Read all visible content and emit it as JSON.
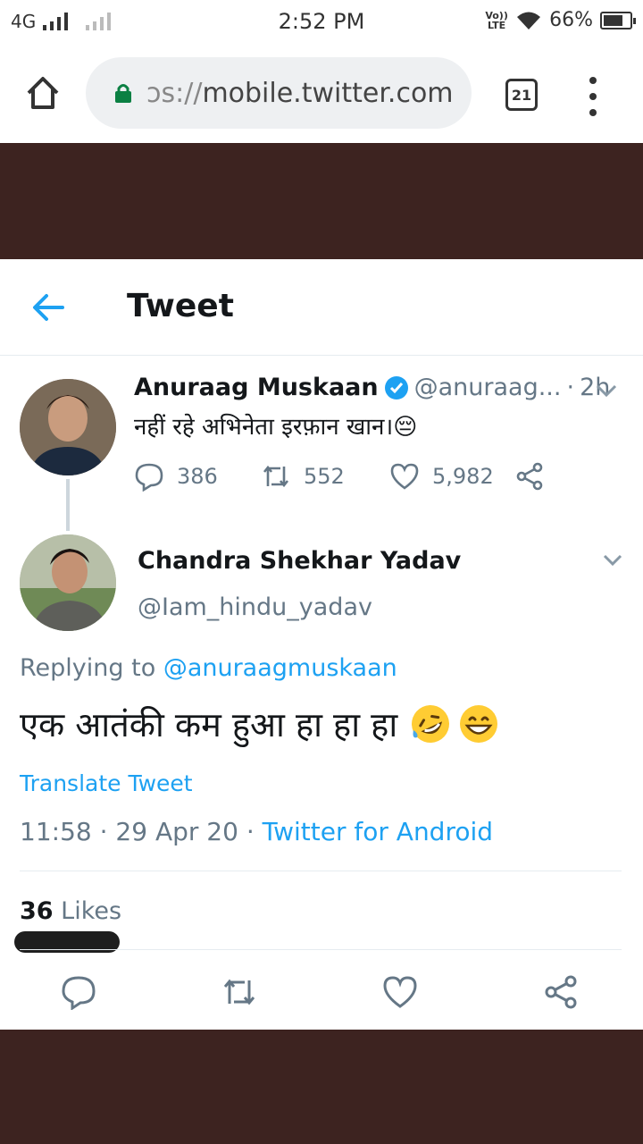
{
  "status_bar": {
    "network": "4G",
    "time": "2:52 PM",
    "volte": "Vo)) LTE",
    "battery": "66%",
    "battery_level": 0.66
  },
  "browser": {
    "url_prefix": "ɔs://",
    "url_host": "mobile.twitter.com",
    "tab_count": "21"
  },
  "header": {
    "title": "Tweet"
  },
  "parent_tweet": {
    "name": "Anuraag Muskaan",
    "handle": "@anuraag...",
    "separator": "·",
    "time": "2h",
    "text": "नहीं रहे अभिनेता इरफ़ान खान।😔",
    "replies": "386",
    "retweets": "552",
    "likes": "5,982"
  },
  "main_tweet": {
    "name": "Chandra Shekhar Yadav",
    "handle": "@Iam_hindu_yadav",
    "replying_label": "Replying to",
    "replying_handle": "@anuraagmuskaan",
    "text": "एक आतंकी कम हुआ हा हा हा",
    "translate": "Translate Tweet",
    "time": "11:58",
    "date": "29 Apr 20",
    "separator": "·",
    "source": "Twitter for Android",
    "likes_count": "36",
    "likes_label": "Likes"
  },
  "colors": {
    "accent": "#1da1f2",
    "muted": "#657786",
    "text": "#14171a",
    "backdrop": "#3d2320"
  }
}
